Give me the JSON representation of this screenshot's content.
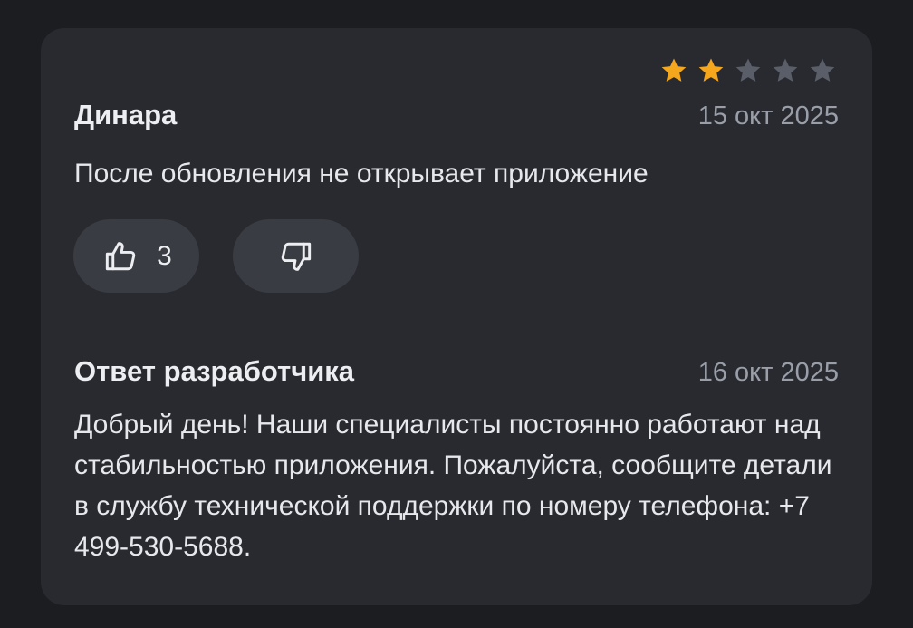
{
  "review": {
    "rating": 2,
    "max_rating": 5,
    "colors": {
      "star_filled": "#f4a61c",
      "star_empty": "#5a5e68"
    },
    "author": "Динара",
    "date": "15 окт 2025",
    "text": "После обновления не открывает приложение",
    "likes": {
      "count": "3",
      "icon": "thumbs-up-icon"
    },
    "dislikes": {
      "icon": "thumbs-down-icon"
    }
  },
  "reply": {
    "title": "Ответ разработчика",
    "date": "16 окт 2025",
    "text": "Добрый день! Наши специалисты постоянно работают над стабильностью приложения. Пожалуйста, сообщите детали в службу технической поддержки по номеру телефона: +7 499-530-5688."
  }
}
